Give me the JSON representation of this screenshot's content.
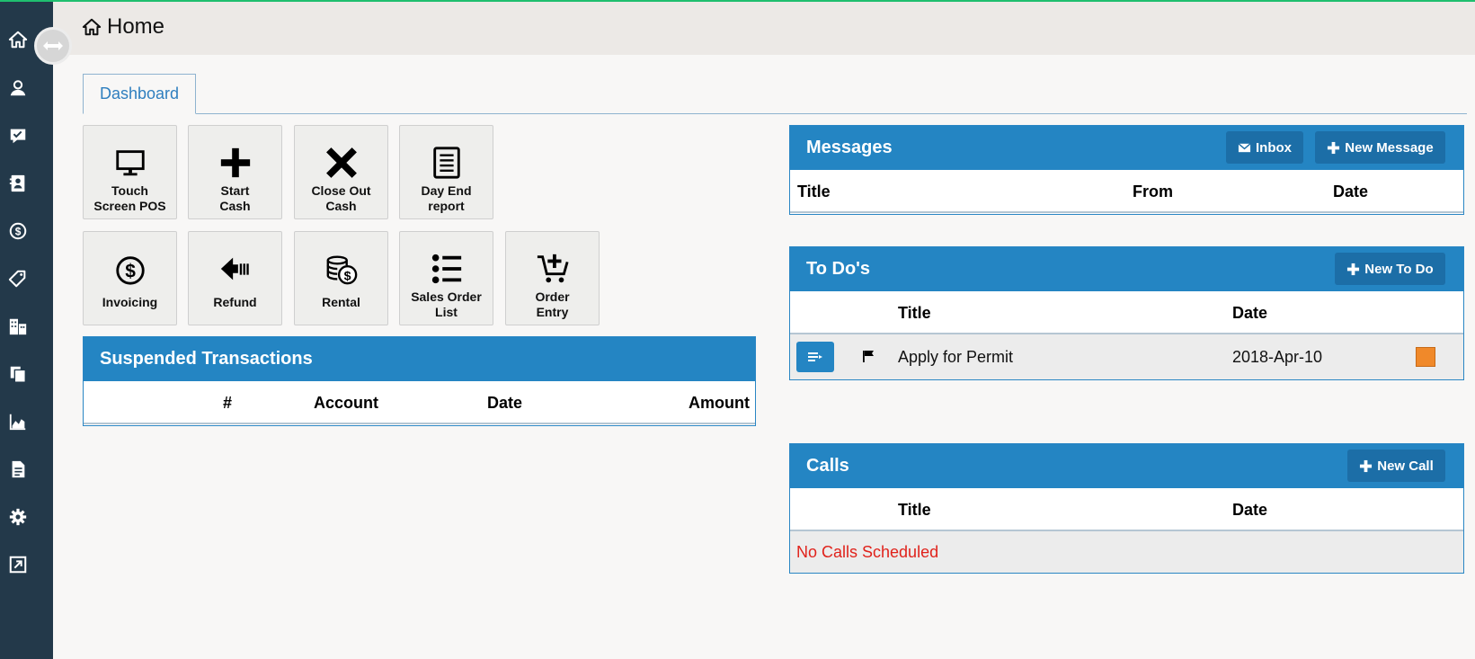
{
  "header": {
    "title": "Home",
    "icon": "home-icon"
  },
  "sidebar": {
    "items": [
      {
        "name": "home-icon"
      },
      {
        "name": "user-icon"
      },
      {
        "name": "checklist-icon"
      },
      {
        "name": "contacts-icon"
      },
      {
        "name": "dollar-icon"
      },
      {
        "name": "tags-icon"
      },
      {
        "name": "buildings-icon"
      },
      {
        "name": "copy-icon"
      },
      {
        "name": "chart-icon"
      },
      {
        "name": "document-icon"
      },
      {
        "name": "gear-icon"
      },
      {
        "name": "external-link-icon"
      }
    ],
    "toggle_icon": "expand-arrows-icon"
  },
  "tabs": [
    {
      "label": "Dashboard",
      "active": true
    }
  ],
  "tiles": [
    {
      "label": "Touch\nScreen POS",
      "icon": "monitor-icon"
    },
    {
      "label": "Start\nCash",
      "icon": "plus-icon"
    },
    {
      "label": "Close Out\nCash",
      "icon": "x-icon"
    },
    {
      "label": "Day End\nreport",
      "icon": "report-icon"
    },
    {
      "label": "Invoicing",
      "icon": "dollar-circle-icon"
    },
    {
      "label": "Refund",
      "icon": "refund-arrow-icon"
    },
    {
      "label": "Rental",
      "icon": "coins-icon"
    },
    {
      "label": "Sales Order\nList",
      "icon": "list-icon"
    },
    {
      "label": "Order\nEntry",
      "icon": "cart-add-icon"
    }
  ],
  "suspended": {
    "title": "Suspended Transactions",
    "columns": [
      "#",
      "Account",
      "Date",
      "Amount"
    ]
  },
  "messages": {
    "title": "Messages",
    "inbox_label": "Inbox",
    "new_label": "New Message",
    "columns": [
      "Title",
      "From",
      "Date"
    ]
  },
  "todos": {
    "title": "To Do's",
    "new_label": "New To Do",
    "columns": [
      "Title",
      "Date"
    ],
    "rows": [
      {
        "title": "Apply for Permit",
        "date": "2018-Apr-10",
        "status_color": "#f0892a"
      }
    ]
  },
  "calls": {
    "title": "Calls",
    "new_label": "New Call",
    "columns": [
      "Title",
      "Date"
    ],
    "empty_text": "No Calls Scheduled",
    "empty_color": "#e0221b"
  },
  "colors": {
    "sidebar": "#23394a",
    "panel_header": "#2485c3",
    "button": "#1c6ea7",
    "accent_line": "#1fbf6f"
  }
}
